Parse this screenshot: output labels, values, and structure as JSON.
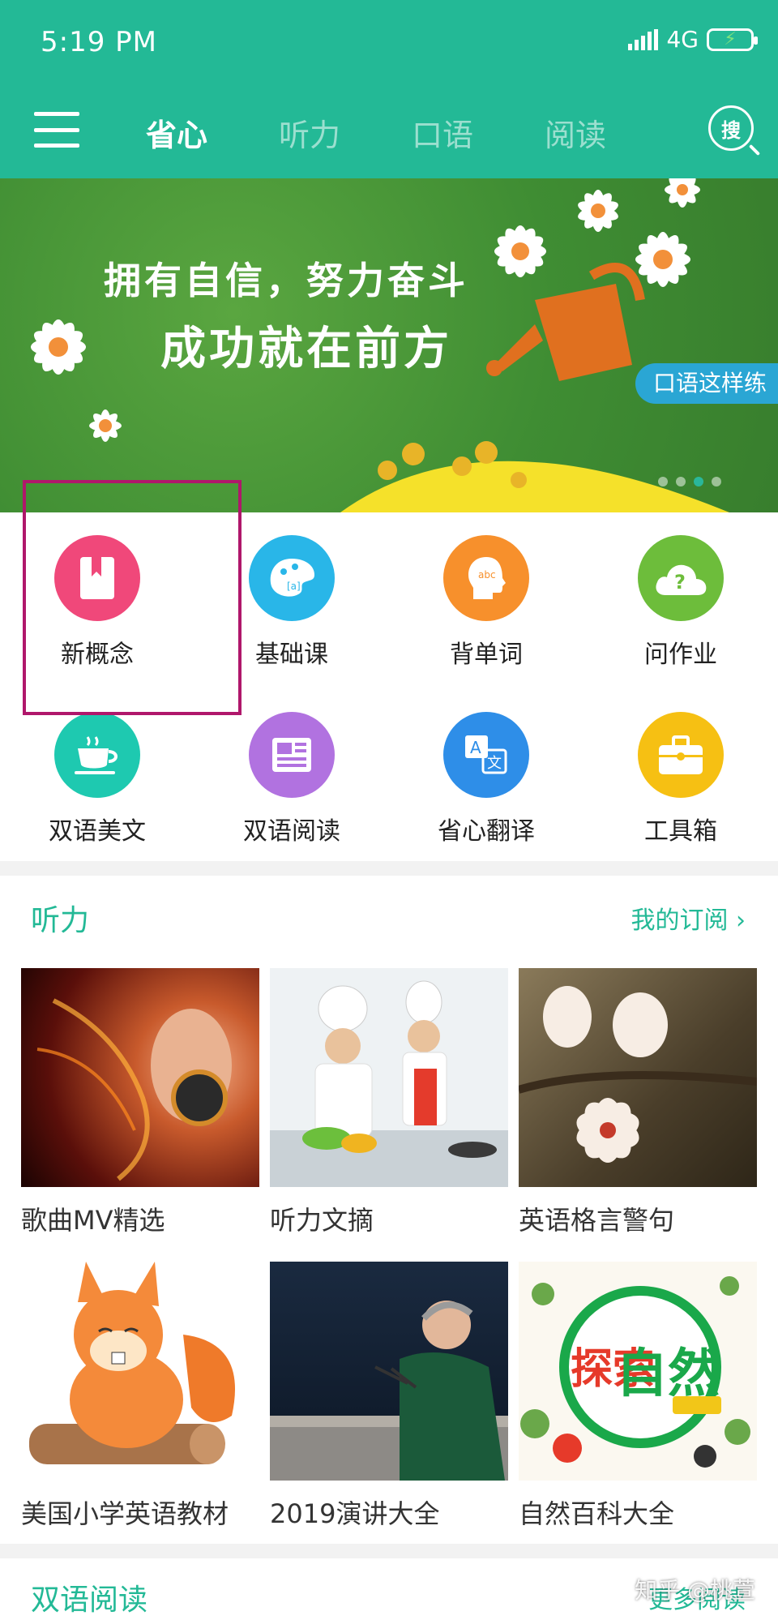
{
  "status_bar": {
    "time": "5:19 PM",
    "network": "4G"
  },
  "nav": {
    "tabs": [
      {
        "label": "省心"
      },
      {
        "label": "听力"
      },
      {
        "label": "口语"
      },
      {
        "label": "阅读"
      }
    ],
    "search_label": "搜"
  },
  "banner": {
    "line1": "拥有自信，努力奋斗",
    "line2": "成功就在前方",
    "pill": "口语这样练"
  },
  "grid": [
    {
      "label": "新概念",
      "icon": "book-icon",
      "color": "#f0487a"
    },
    {
      "label": "基础课",
      "icon": "palette-icon",
      "color": "#29b6e8"
    },
    {
      "label": "背单词",
      "icon": "head-abc-icon",
      "color": "#f7902c"
    },
    {
      "label": "问作业",
      "icon": "cloud-question-icon",
      "color": "#6dbd3b"
    },
    {
      "label": "双语美文",
      "icon": "teacup-icon",
      "color": "#1ec9b0"
    },
    {
      "label": "双语阅读",
      "icon": "newspaper-icon",
      "color": "#b172e0"
    },
    {
      "label": "省心翻译",
      "icon": "translate-icon",
      "color": "#2e8ee8"
    },
    {
      "label": "工具箱",
      "icon": "toolbox-icon",
      "color": "#f6c013"
    }
  ],
  "listening": {
    "title": "听力",
    "more": "我的订阅 ›",
    "cards": [
      {
        "label": "歌曲MV精选"
      },
      {
        "label": "听力文摘"
      },
      {
        "label": "英语格言警句"
      },
      {
        "label": "美国小学英语教材"
      },
      {
        "label": "2019演讲大全"
      },
      {
        "label": "自然百科大全"
      }
    ]
  },
  "bilingual": {
    "title": "双语阅读",
    "more": "更多阅读"
  },
  "watermark": "知乎 @桃萱"
}
